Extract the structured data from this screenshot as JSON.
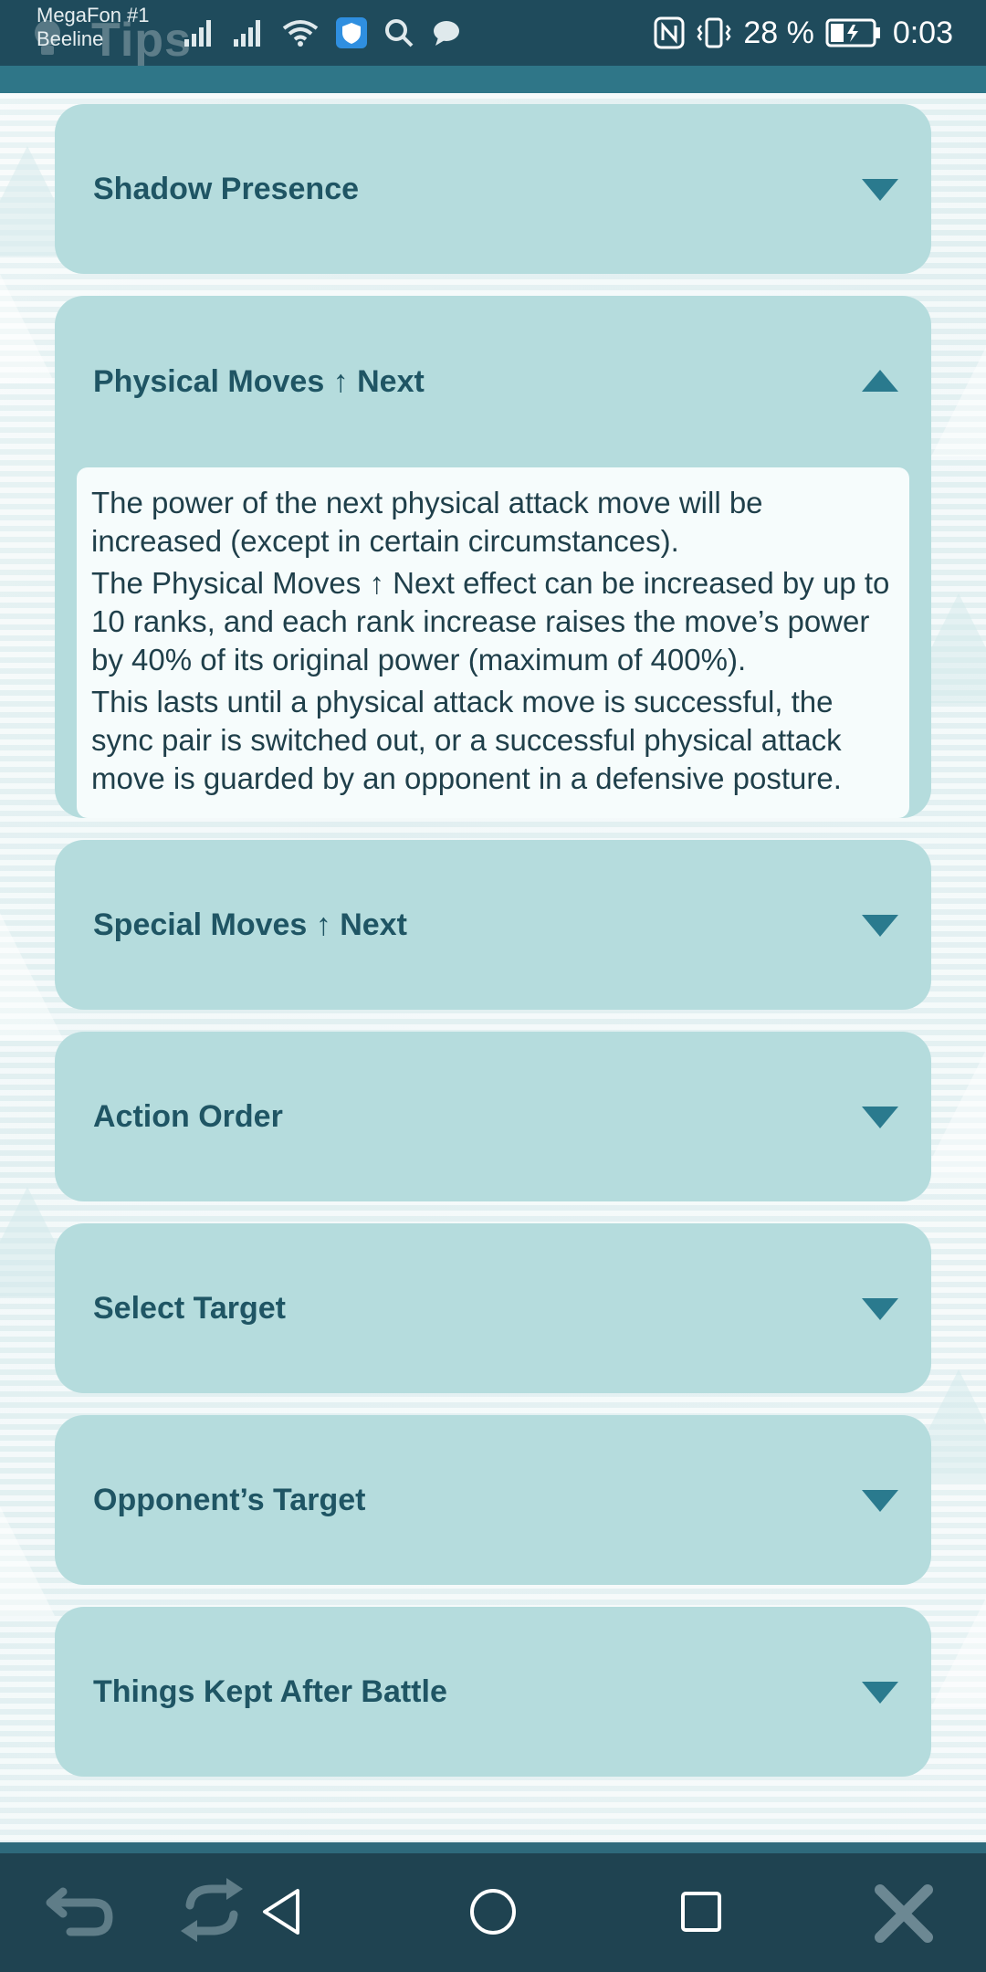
{
  "status_bar": {
    "carrier_1": "MegaFon #1",
    "carrier_2": "Beeline",
    "app_title_ghost": "Tips",
    "battery_text": "28 %",
    "time": "0:03"
  },
  "accordion": {
    "items": [
      {
        "title": "Shadow Presence",
        "expanded": false
      },
      {
        "title": "Physical Moves ↑ Next",
        "expanded": true,
        "body": [
          "The power of the next physical attack move will be increased (except in certain circumstances).",
          "The Physical Moves ↑ Next effect can be increased by up to 10 ranks, and each rank increase raises the move’s power by 40% of its original power (maximum of 400%).",
          "This lasts until a physical attack move is successful, the sync pair is switched out, or a successful physical attack move is guarded by an opponent in a defensive posture."
        ]
      },
      {
        "title": "Special Moves ↑ Next",
        "expanded": false
      },
      {
        "title": "Action Order",
        "expanded": false
      },
      {
        "title": "Select Target",
        "expanded": false
      },
      {
        "title": "Opponent’s Target",
        "expanded": false
      },
      {
        "title": "Things Kept After Battle",
        "expanded": false
      }
    ]
  },
  "colors": {
    "status_bar": "#1f4b5c",
    "card": "#b5dcdd",
    "title_text": "#1f5564",
    "chevron": "#2a7a8e",
    "bottom_bar": "#1f4351"
  },
  "icons": {
    "signal": "signal-icon",
    "wifi": "wifi-icon",
    "shield": "shield-icon",
    "search": "search-icon",
    "chat": "chat-icon",
    "nfc": "nfc-icon",
    "vibrate": "vibrate-icon",
    "battery": "battery-icon",
    "back_arrow": "back-arrow-icon",
    "refresh": "refresh-icon",
    "nav_back": "nav-back-icon",
    "nav_home": "nav-home-icon",
    "nav_recents": "nav-recents-icon",
    "close": "close-icon"
  }
}
